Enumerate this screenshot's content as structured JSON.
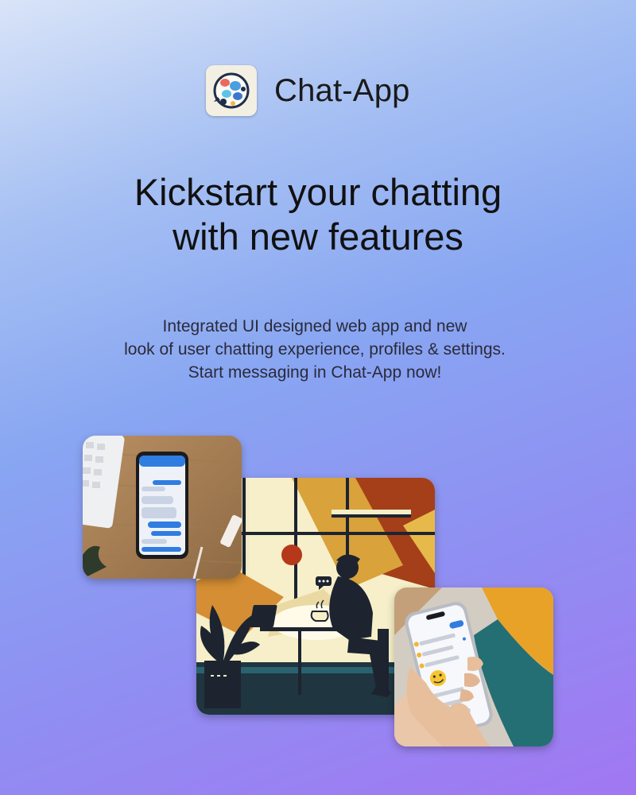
{
  "brand": {
    "name": "Chat-App",
    "logo_icon": "chat-bubbles-globe-icon"
  },
  "hero": {
    "headline_lines": [
      "Kickstart your chatting",
      "with new features"
    ],
    "subtext_lines": [
      "Integrated UI designed web app and new",
      "look of user chatting experience, profiles & settings.",
      "Start messaging in Chat-App now!"
    ]
  },
  "images": [
    {
      "name": "phone-on-desk-image",
      "description_icon": "smartphone-chat-icon"
    },
    {
      "name": "person-chatting-illustration",
      "description_icon": "person-silhouette-icon"
    },
    {
      "name": "hand-holding-phone-image",
      "description_icon": "hand-phone-icon"
    }
  ],
  "colors": {
    "gradient_top": "#d9e4f8",
    "gradient_mid": "#88a6f2",
    "gradient_bottom": "#a177f2",
    "chat_blue": "#2f7de1"
  }
}
